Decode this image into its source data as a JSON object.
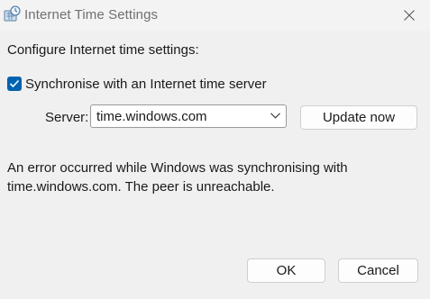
{
  "window": {
    "title": "Internet Time Settings",
    "icon": "clock-globe-icon"
  },
  "content": {
    "heading": "Configure Internet time settings:",
    "sync_checkbox": {
      "label": "Synchronise with an Internet time server",
      "checked": true
    },
    "server": {
      "label": "Server:",
      "value": "time.windows.com"
    },
    "update_button": "Update now",
    "error_line1": "An error occurred while Windows was synchronising with",
    "error_line2": "time.windows.com.  The peer is unreachable."
  },
  "footer": {
    "ok": "OK",
    "cancel": "Cancel"
  },
  "colors": {
    "accent": "#0063b1",
    "background": "#f0f0f0"
  }
}
